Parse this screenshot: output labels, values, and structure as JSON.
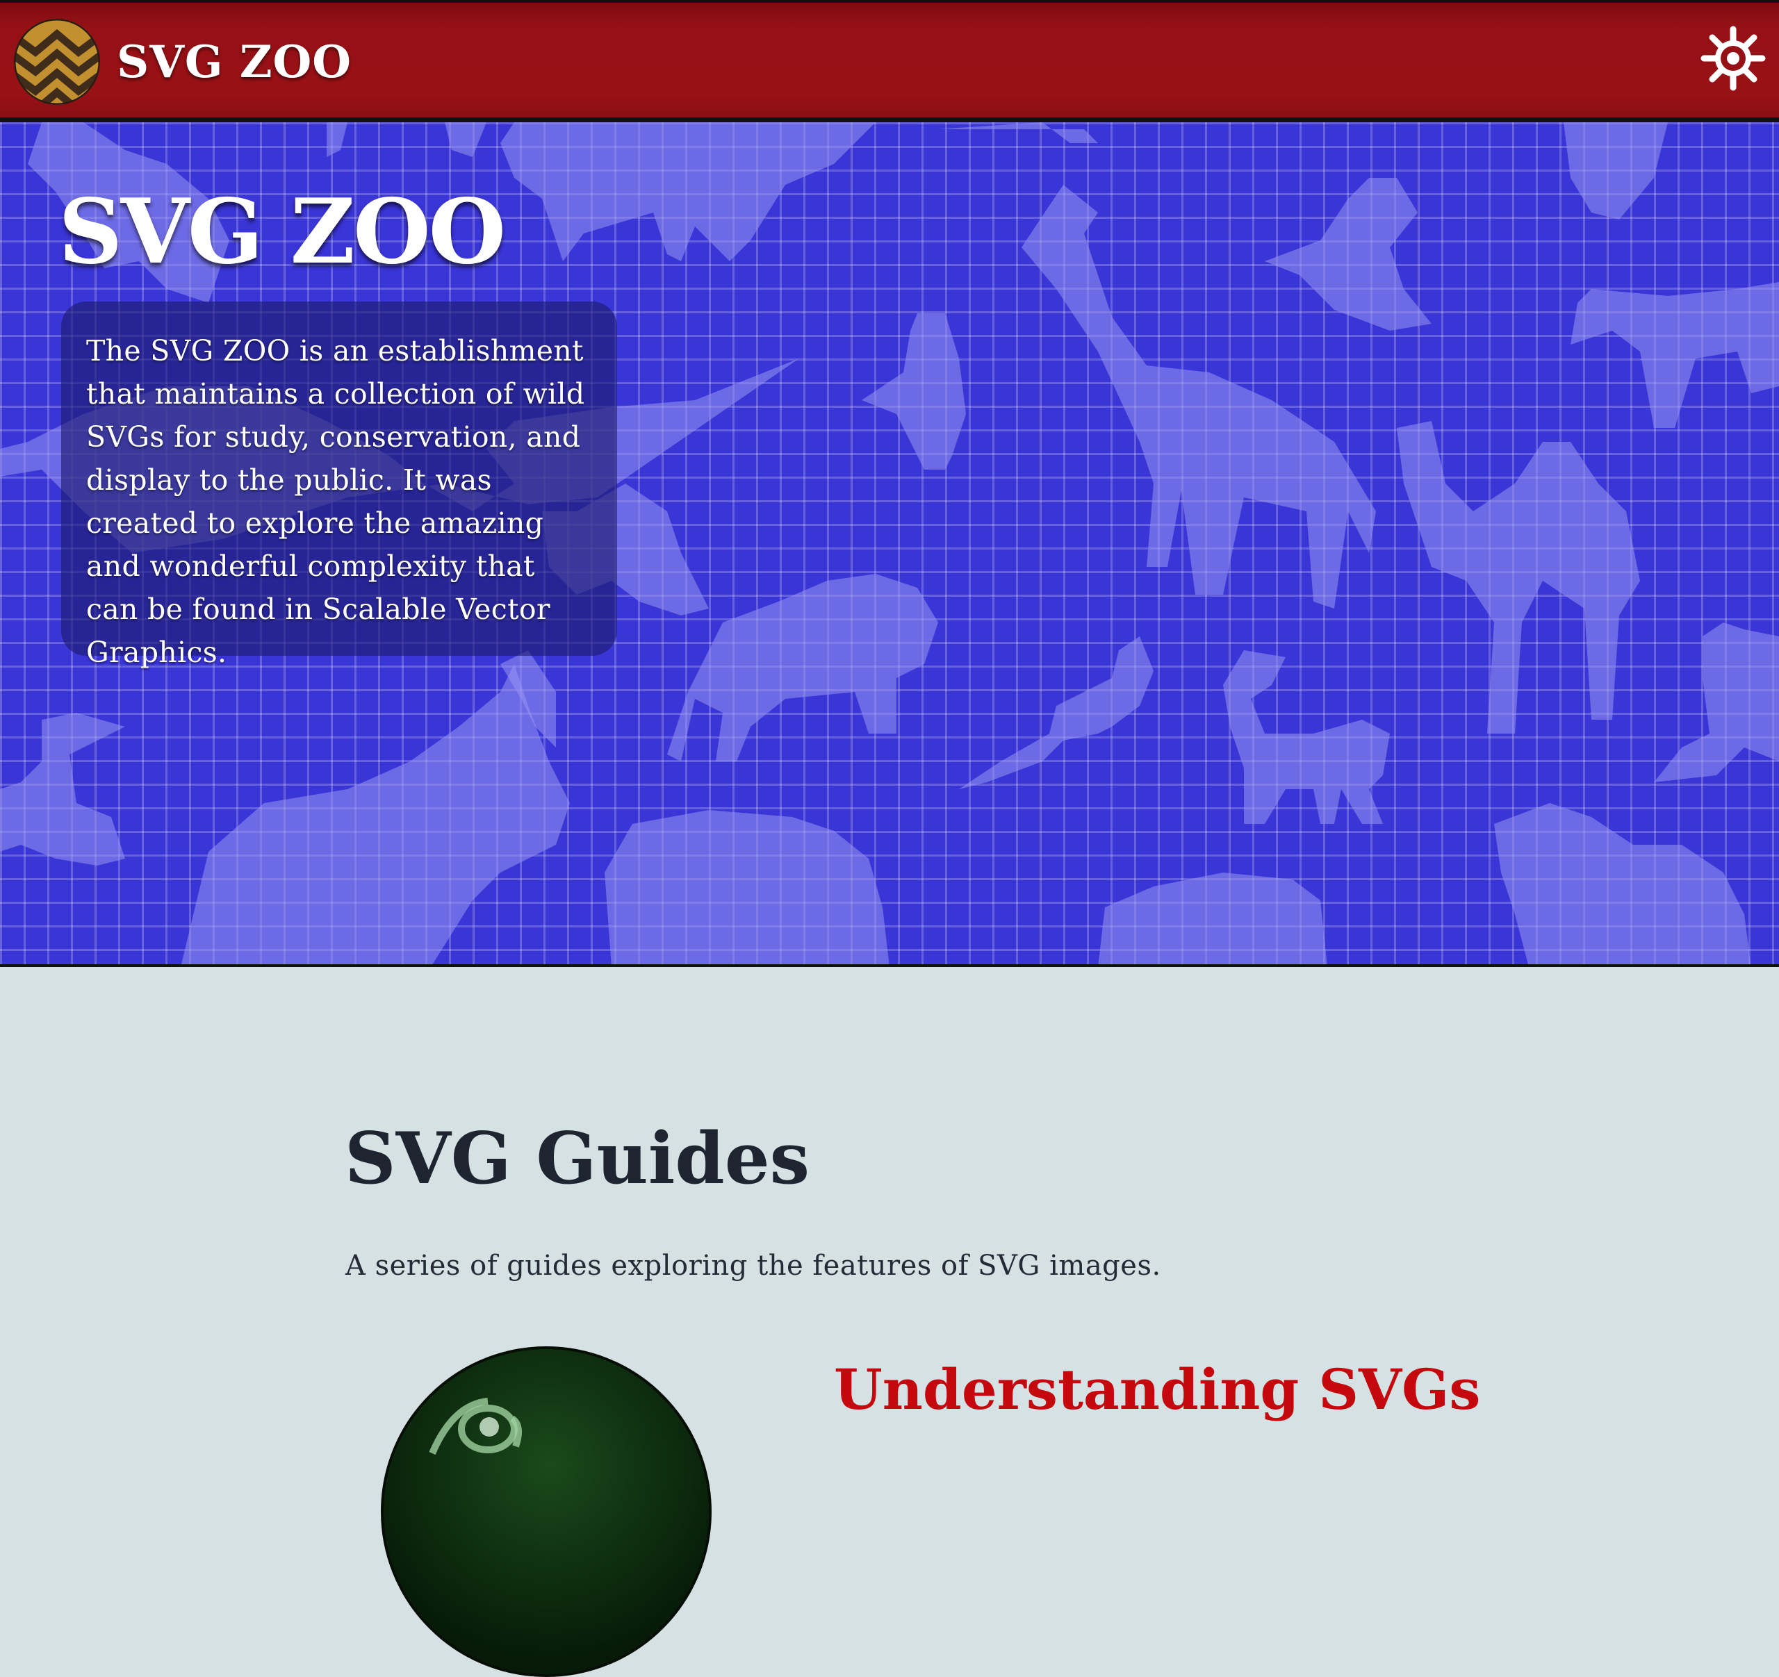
{
  "header": {
    "brand": "SVG ZOO",
    "logo_icon": "chevron-badge-icon",
    "settings_icon": "gear-icon"
  },
  "hero": {
    "title": "SVG ZOO",
    "description": "The SVG ZOO is an establishment that maintains a collection of wild SVGs for study, conservation, and display to the public. It was created to explore the amazing and wonderful complexity that can be found in Scalable Vector Graphics."
  },
  "main": {
    "title": "SVG Guides",
    "description": "A series of guides exploring the features of SVG images.",
    "guides": [
      {
        "title": "Understanding SVGs"
      }
    ]
  },
  "colors": {
    "header_red": "#951116",
    "hero_blue": "#3a35d6",
    "page_bg": "#d5e1e3",
    "guide_title_red": "#c4080e"
  }
}
